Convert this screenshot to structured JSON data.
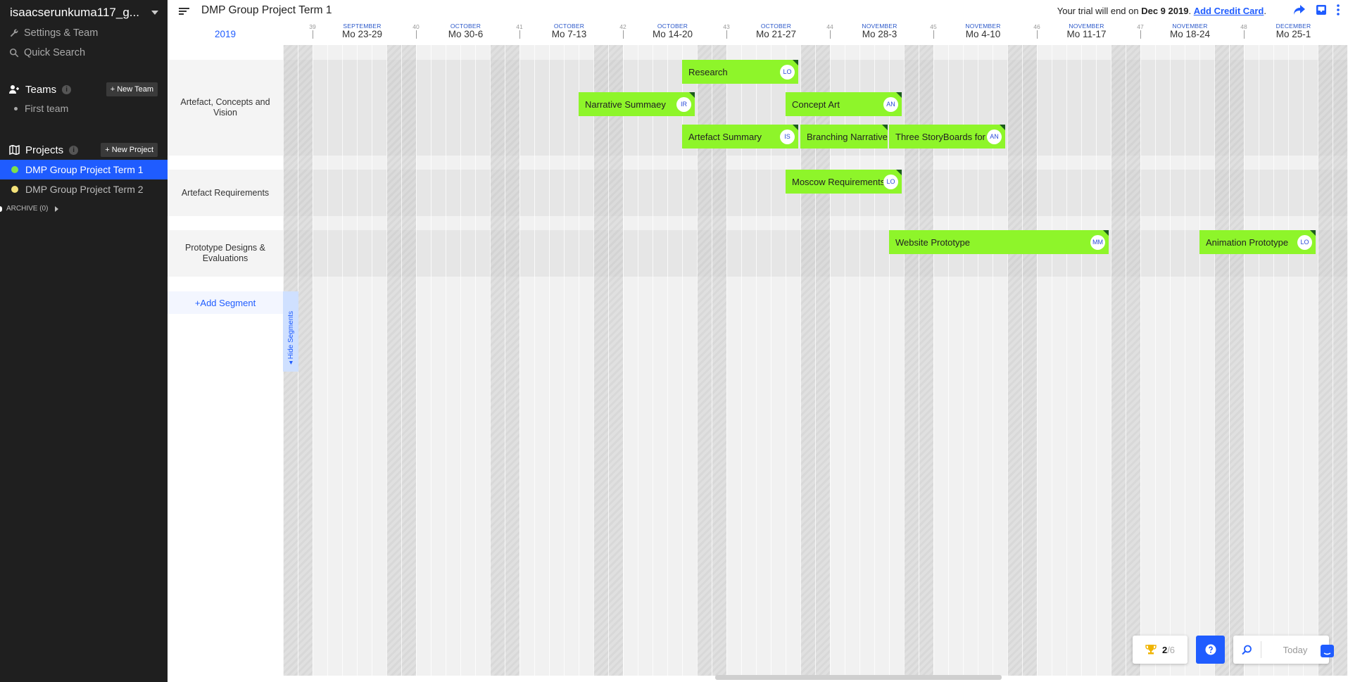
{
  "sidebar": {
    "account_name": "isaacserunkuma117_g...",
    "settings_label": "Settings & Team",
    "search_label": "Quick Search",
    "teams_label": "Teams",
    "new_team_label": "+ New Team",
    "teams": [
      "First team"
    ],
    "projects_label": "Projects",
    "new_project_label": "+ New Project",
    "projects": [
      {
        "name": "DMP Group Project Term 1",
        "color": "#7ee04a",
        "active": true
      },
      {
        "name": "DMP Group Project Term 2",
        "color": "#f4e27a",
        "active": false
      }
    ],
    "archive_label": "ARCHIVE (0)"
  },
  "header": {
    "project_title": "DMP Group Project Term 1",
    "trial_prefix": "Your trial will end on ",
    "trial_date": "Dec 9 2019",
    "trial_dot": ".",
    "add_card": "Add Credit Card",
    "trial_suffix": "."
  },
  "timeline": {
    "year": "2019",
    "weeks": [
      {
        "num": "39",
        "month": "SEPTEMBER",
        "range": "Mo 23-29"
      },
      {
        "num": "40",
        "month": "OCTOBER",
        "range": "Mo 30-6"
      },
      {
        "num": "41",
        "month": "OCTOBER",
        "range": "Mo 7-13"
      },
      {
        "num": "42",
        "month": "OCTOBER",
        "range": "Mo 14-20"
      },
      {
        "num": "43",
        "month": "OCTOBER",
        "range": "Mo 21-27"
      },
      {
        "num": "44",
        "month": "NOVEMBER",
        "range": "Mo 28-3"
      },
      {
        "num": "45",
        "month": "NOVEMBER",
        "range": "Mo 4-10"
      },
      {
        "num": "46",
        "month": "NOVEMBER",
        "range": "Mo 11-17"
      },
      {
        "num": "47",
        "month": "NOVEMBER",
        "range": "Mo 18-24"
      },
      {
        "num": "48",
        "month": "DECEMBER",
        "range": "Mo 25-1"
      }
    ],
    "segments": [
      {
        "name": "Artefact, Concepts and Vision"
      },
      {
        "name": "Artefact Requirements"
      },
      {
        "name": "Prototype Designs & Evaluations"
      }
    ],
    "add_segment": "+Add Segment",
    "hide_segments": "◂ Hide Segments",
    "tasks": [
      {
        "name": "Research",
        "assignee": "LO"
      },
      {
        "name": "Narrative Summaey",
        "assignee": "IR"
      },
      {
        "name": "Concept Art",
        "assignee": "AN"
      },
      {
        "name": "Artefact Summary",
        "assignee": "IS"
      },
      {
        "name": "Branching Narrative",
        "assignee": ""
      },
      {
        "name": "Three StoryBoards for",
        "assignee": "AN"
      },
      {
        "name": "Moscow Requirements",
        "assignee": "LO"
      },
      {
        "name": "Website Prototype",
        "assignee": "MM"
      },
      {
        "name": "Animation Prototype",
        "assignee": "LO"
      }
    ],
    "task_color": "#8ef52a"
  },
  "footer": {
    "progress_done": "2",
    "progress_total": "/6",
    "today_label": "Today"
  },
  "colors": {
    "accent": "#1f5cff",
    "sidebar_bg": "#1f1f1f",
    "task_green": "#8ef52a"
  }
}
